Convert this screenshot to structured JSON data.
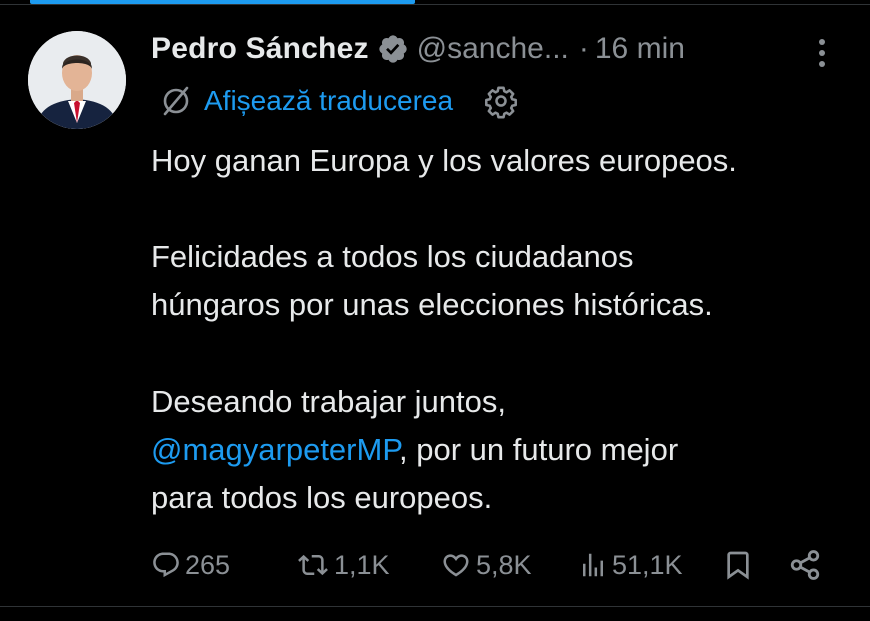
{
  "tweet": {
    "author_name": "Pedro Sánchez",
    "handle": "@sanche...",
    "separator": "·",
    "time": "16 min",
    "translate_label": "Afișează traducerea",
    "text_lines": [
      "Hoy ganan Europa y los valores europeos.",
      "Felicidades a todos los ciudadanos",
      "húngaros por unas elecciones históricas.",
      "Deseando trabajar juntos,"
    ],
    "mention": "@magyarpeterMP",
    "mention_suffix": ", por un futuro mejor",
    "last_line": "para todos los europeos."
  },
  "actions": {
    "replies": "265",
    "reposts": "1,1K",
    "likes": "5,8K",
    "views": "51,1K"
  },
  "colors": {
    "background": "#000000",
    "text": "#e7e9ea",
    "muted": "#8b9095",
    "accent": "#1d9bf0"
  },
  "icons": [
    "verified-badge-icon",
    "more-options-icon",
    "translate-globe-icon",
    "settings-gear-icon",
    "reply-icon",
    "repost-icon",
    "like-icon",
    "views-icon",
    "bookmark-icon",
    "share-icon"
  ]
}
